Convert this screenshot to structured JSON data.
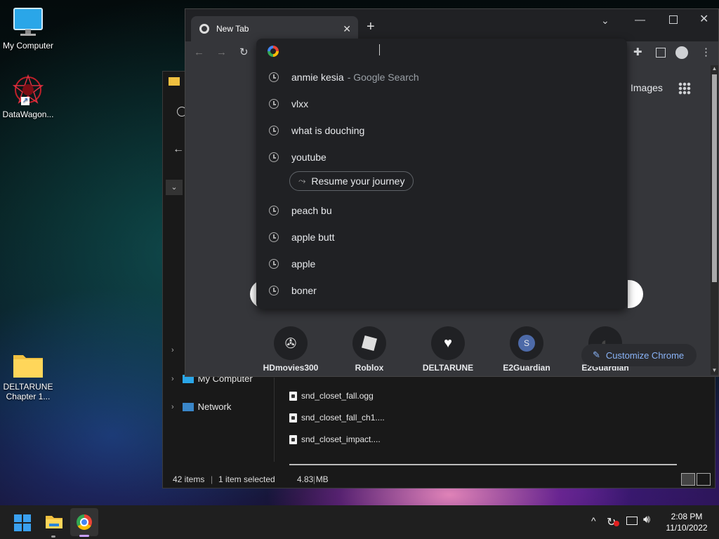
{
  "desktop": {
    "icons": [
      {
        "label": "My Computer"
      },
      {
        "label": "DataWagon..."
      },
      {
        "label": "DELTARUNE Chapter 1..."
      }
    ]
  },
  "explorer": {
    "nav": {
      "my_computer": "My Computer",
      "network": "Network"
    },
    "files": [
      "snd_closet_fall.ogg",
      "snd_closet_fall_ch1....",
      "snd_closet_impact...."
    ],
    "status": {
      "count": "42 items",
      "selected": "1 item selected",
      "size": "4.83 MB"
    }
  },
  "chrome": {
    "tab_title": "New Tab",
    "header": {
      "images_link": "Images"
    },
    "omnibox": {
      "value": "",
      "suggestions": [
        {
          "text": "anmie kesia",
          "suffix": "- Google Search"
        },
        {
          "text": "vlxx"
        },
        {
          "text": "what is douching"
        },
        {
          "text": "youtube"
        },
        {
          "text": "peach bu"
        },
        {
          "text": "apple butt"
        },
        {
          "text": "apple"
        },
        {
          "text": "boner"
        }
      ],
      "journey_chip": "Resume your journey"
    },
    "shortcuts": [
      {
        "label": "HDmovies300",
        "letter": ""
      },
      {
        "label": "Roblox",
        "letter": ""
      },
      {
        "label": "DELTARUNE",
        "letter": ""
      },
      {
        "label": "E2Guardian",
        "letter": "S"
      },
      {
        "label": "E2Guardian",
        "letter": ""
      }
    ],
    "customize_label": "Customize Chrome"
  },
  "taskbar": {
    "time": "2:08 PM",
    "date": "11/10/2022"
  },
  "colors": {
    "chrome_dark": "#202124",
    "chrome_mid": "#35363a",
    "link_blue": "#8ab4f8",
    "shortcut_s": "#4d6aa8"
  }
}
